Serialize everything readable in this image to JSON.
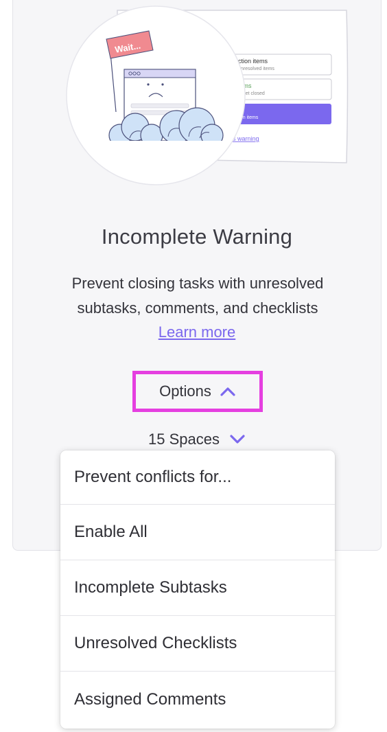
{
  "illustration": {
    "flag_text": "Wait...",
    "form": {
      "row1_title": "ction items",
      "row1_sub": "unresolved items",
      "row2_title": "tems",
      "row2_sub": "aren't yet closed",
      "button_sub": "action items",
      "link": "s warning"
    }
  },
  "card": {
    "title": "Incomplete Warning",
    "description": "Prevent closing tasks with unresolved subtasks, comments, and checklists",
    "learn_more": "Learn more",
    "options_label": "Options",
    "spaces_label": "15 Spaces"
  },
  "dropdown": {
    "header": "Prevent conflicts for...",
    "items": [
      {
        "label": "Enable All"
      },
      {
        "label": "Incomplete Subtasks"
      },
      {
        "label": "Unresolved Checklists"
      },
      {
        "label": "Assigned Comments"
      }
    ]
  },
  "colors": {
    "accent": "#7b68ee",
    "highlight": "#e53fe0",
    "flag": "#f08a90",
    "card_bg": "#f6f6f8"
  }
}
